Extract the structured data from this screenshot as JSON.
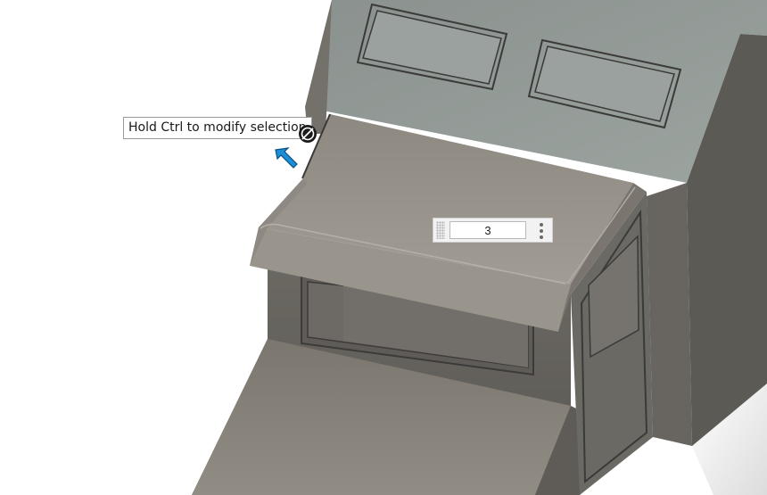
{
  "tooltip": {
    "text": "Hold Ctrl to modify selection"
  },
  "value_input": {
    "value": "3"
  },
  "icons": {
    "cursor": "select-arrow-cursor-icon",
    "cursor_badge": "pointer-badge-icon",
    "grip": "drag-grip-icon",
    "more": "more-options-icon"
  },
  "colors": {
    "canvas": "#ffffff",
    "model_top": "#96918a",
    "model_side": "#625f59",
    "upper_block": "#848b88",
    "cursor_arrow": "#1b8fd6"
  }
}
